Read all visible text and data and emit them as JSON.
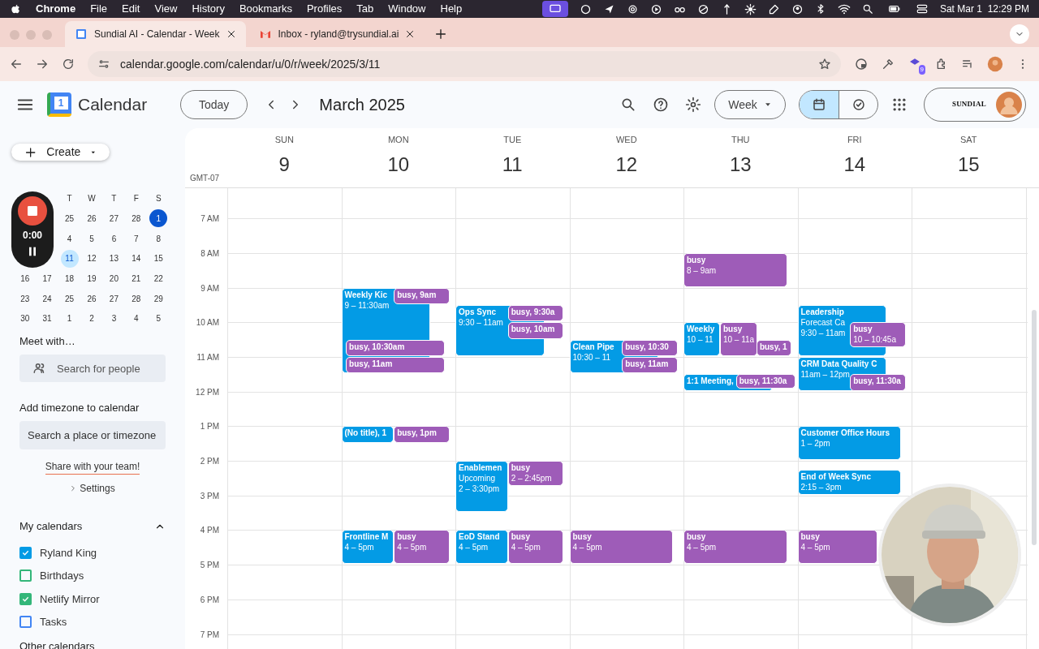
{
  "menu_bar": {
    "app": "Chrome",
    "items": [
      "File",
      "Edit",
      "View",
      "History",
      "Bookmarks",
      "Profiles",
      "Tab",
      "Window",
      "Help"
    ],
    "clock": "Sat Mar 1  12:29 PM"
  },
  "browser": {
    "tabs": [
      {
        "title": "Sundial AI - Calendar - Week",
        "selected": true
      },
      {
        "title": "Inbox - ryland@trysundial.ai",
        "selected": false
      }
    ],
    "url": "calendar.google.com/calendar/u/0/r/week/2025/3/11",
    "extension_badge": "9"
  },
  "header": {
    "logo_day": "1",
    "app_name": "Calendar",
    "today_button": "Today",
    "period": "March 2025",
    "view_button": "Week",
    "view_toggle": [
      {
        "kind": "calendar",
        "selected": true
      },
      {
        "kind": "tasks",
        "selected": false
      }
    ],
    "account_logo": "SUNDIAL"
  },
  "sidebar": {
    "create_button": "Create",
    "mini_calendar": {
      "weekdays": [
        "T",
        "W",
        "T",
        "F",
        "S"
      ],
      "weeks": [
        [
          "25",
          "26",
          "27",
          "28",
          {
            "day": "1",
            "today": true
          }
        ],
        [
          "4",
          "5",
          "6",
          "7",
          "8"
        ],
        [
          {
            "day": "11",
            "selected": true
          },
          "12",
          "13",
          "14",
          "15"
        ],
        [
          "16",
          "17",
          "18",
          "19",
          "20",
          "21",
          "22"
        ],
        [
          "23",
          "24",
          "25",
          "26",
          "27",
          "28",
          "29"
        ],
        [
          "30",
          "31",
          "1",
          "2",
          "3",
          "4",
          "5"
        ]
      ]
    },
    "recorder": {
      "timer": "0:00"
    },
    "meet_title": "Meet with…",
    "people_search": {
      "placeholder": "Search for people"
    },
    "timezone_title": "Add timezone to calendar",
    "timezone_search": {
      "placeholder": "Search a place or timezone"
    },
    "share_link": "Share with your team!",
    "settings_link": "Settings",
    "my_calendars": {
      "title": "My calendars",
      "expanded": true,
      "items": [
        {
          "name": "Ryland King",
          "checked": true,
          "color": "#039be5"
        },
        {
          "name": "Birthdays",
          "checked": false,
          "color": "#33b679"
        },
        {
          "name": "Netlify Mirror",
          "checked": true,
          "color": "#33b679"
        },
        {
          "name": "Tasks",
          "checked": false,
          "color": "#4285f4"
        }
      ]
    },
    "other_calendars": "Other calendars"
  },
  "week": {
    "timezone": "GMT-07",
    "hours": [
      "7 AM",
      "8 AM",
      "9 AM",
      "10 AM",
      "11 AM",
      "12 PM",
      "1 PM",
      "2 PM",
      "3 PM",
      "4 PM",
      "5 PM",
      "6 PM",
      "7 PM"
    ],
    "days": [
      {
        "weekday": "SUN",
        "date": "9"
      },
      {
        "weekday": "MON",
        "date": "10",
        "events": [
          {
            "color": "#039be5",
            "lines": [
              "Weekly Kic",
              "9 – 11:30am"
            ]
          },
          {
            "color": "#9e5cb8",
            "lines": [
              "busy, 9am"
            ]
          },
          {
            "color": "#9e5cb8",
            "lines": [
              "busy, 10:30am"
            ]
          },
          {
            "color": "#9e5cb8",
            "lines": [
              "busy, 11am"
            ]
          },
          {
            "color": "#039be5",
            "lines": [
              "(No title), 1"
            ]
          },
          {
            "color": "#9e5cb8",
            "lines": [
              "busy, 1pm"
            ]
          },
          {
            "color": "#039be5",
            "lines": [
              "Frontline M",
              "4 – 5pm"
            ]
          },
          {
            "color": "#9e5cb8",
            "lines": [
              "busy",
              "4 – 5pm"
            ]
          }
        ]
      },
      {
        "weekday": "TUE",
        "date": "11",
        "events": [
          {
            "color": "#039be5",
            "lines": [
              "Ops Sync",
              "9:30 – 11am"
            ]
          },
          {
            "color": "#9e5cb8",
            "lines": [
              "busy, 9:30a"
            ]
          },
          {
            "color": "#9e5cb8",
            "lines": [
              "busy, 10am"
            ]
          },
          {
            "color": "#039be5",
            "lines": [
              "Enablemen",
              "Upcoming",
              "2 – 3:30pm"
            ]
          },
          {
            "color": "#9e5cb8",
            "lines": [
              "busy",
              "2 – 2:45pm"
            ]
          },
          {
            "color": "#039be5",
            "lines": [
              "EoD Stand",
              "4 – 5pm"
            ]
          },
          {
            "color": "#9e5cb8",
            "lines": [
              "busy",
              "4 – 5pm"
            ]
          }
        ]
      },
      {
        "weekday": "WED",
        "date": "12",
        "events": [
          {
            "color": "#039be5",
            "lines": [
              "Clean Pipe",
              "10:30 – 11"
            ]
          },
          {
            "color": "#9e5cb8",
            "lines": [
              "busy, 10:30"
            ]
          },
          {
            "color": "#9e5cb8",
            "lines": [
              "busy, 11am"
            ]
          },
          {
            "color": "#9e5cb8",
            "lines": [
              "busy",
              "4 – 5pm"
            ]
          }
        ]
      },
      {
        "weekday": "THU",
        "date": "13",
        "events": [
          {
            "color": "#9e5cb8",
            "lines": [
              "busy",
              "8 – 9am"
            ]
          },
          {
            "color": "#039be5",
            "lines": [
              "Weekly",
              "10 – 11"
            ]
          },
          {
            "color": "#9e5cb8",
            "lines": [
              "busy",
              "10 – 11a"
            ]
          },
          {
            "color": "#9e5cb8",
            "lines": [
              "busy, 1"
            ]
          },
          {
            "color": "#039be5",
            "lines": [
              "1:1 Meeting,"
            ]
          },
          {
            "color": "#9e5cb8",
            "lines": [
              "busy, 11:30a"
            ]
          },
          {
            "color": "#9e5cb8",
            "lines": [
              "busy",
              "4 – 5pm"
            ]
          }
        ]
      },
      {
        "weekday": "FRI",
        "date": "14",
        "events": [
          {
            "color": "#039be5",
            "lines": [
              "Leadership",
              "Forecast Ca",
              "9:30 – 11am"
            ]
          },
          {
            "color": "#9e5cb8",
            "lines": [
              "busy",
              "10 – 10:45a"
            ]
          },
          {
            "color": "#039be5",
            "lines": [
              "CRM Data Quality C",
              "11am – 12pm"
            ]
          },
          {
            "color": "#9e5cb8",
            "lines": [
              "busy, 11:30a"
            ]
          },
          {
            "color": "#039be5",
            "lines": [
              "Customer Office Hours",
              "1 – 2pm"
            ]
          },
          {
            "color": "#039be5",
            "lines": [
              "End of Week Sync",
              "2:15 – 3pm"
            ]
          },
          {
            "color": "#9e5cb8",
            "lines": [
              "busy",
              "4 – 5pm"
            ]
          }
        ]
      },
      {
        "weekday": "SAT",
        "date": "15"
      }
    ]
  }
}
